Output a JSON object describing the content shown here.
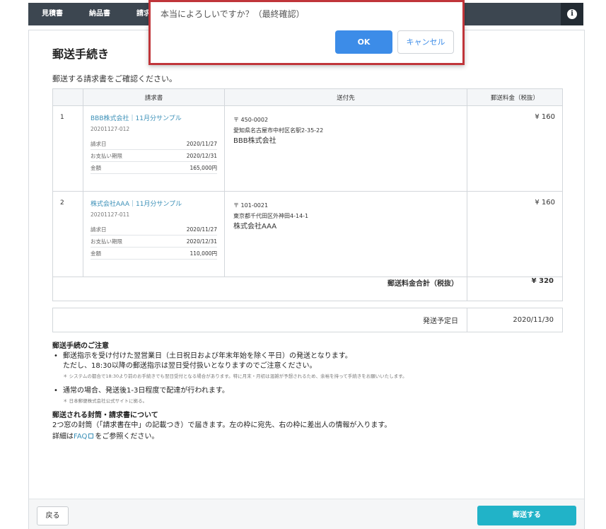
{
  "nav": {
    "items": [
      "見積書",
      "納品書",
      "請求"
    ],
    "info_glyph": "i"
  },
  "page": {
    "title": "郵送手続き",
    "intro": "郵送する請求書をご確認ください。"
  },
  "table": {
    "headers": [
      "",
      "請求書",
      "送付先",
      "郵送料金（税抜）"
    ],
    "rows": [
      {
        "num": "1",
        "invoice_title": "BBB株式会社｜11月分サンプル",
        "invoice_id": "20201127-012",
        "details": [
          {
            "label": "請求日",
            "value": "2020/11/27"
          },
          {
            "label": "お支払い期限",
            "value": "2020/12/31"
          },
          {
            "label": "金額",
            "value": "165,000円"
          }
        ],
        "postal": "〒 450-0002",
        "address": "愛知県名古屋市中村区名駅2-35-22",
        "company": "BBB株式会社",
        "fee": "¥ 160"
      },
      {
        "num": "2",
        "invoice_title": "株式会社AAA｜11月分サンプル",
        "invoice_id": "20201127-011",
        "details": [
          {
            "label": "請求日",
            "value": "2020/11/27"
          },
          {
            "label": "お支払い期限",
            "value": "2020/12/31"
          },
          {
            "label": "金額",
            "value": "110,000円"
          }
        ],
        "postal": "〒 101-0021",
        "address": "東京都千代田区外神田4-14-1",
        "company": "株式会社AAA",
        "fee": "¥ 160"
      }
    ],
    "total_label": "郵送料金合計（税抜）",
    "total_value": "¥ 320"
  },
  "shipping": {
    "label": "発送予定日",
    "date": "2020/11/30"
  },
  "notes": {
    "heading1": "郵送手続のご注意",
    "bullet1_line1": "郵送指示を受け付けた翌営業日（土日祝日および年末年始を除く平日）の発送となります。",
    "bullet1_line2": "ただし、18:30以降の郵送指示は翌日受付扱いとなりますのでご注意ください。",
    "bullet1_small": "＊ システムの都合で18:30より前のお手続きでも翌日受付となる場合があります。特に月末・月初は混雑が予想されるため、余裕を持って手続きをお願いいたします。",
    "bullet2": "通常の場合、発送後1-3日程度で配達が行われます。",
    "bullet2_small": "＊ 日本郵便株式会社公式サイトに拠る。",
    "heading2": "郵送される封筒・請求書について",
    "envelope_text": "2つ窓の封筒（「請求書在中」の記載つき）で届きます。左の枠に宛先、右の枠に差出人の情報が入ります。",
    "detail_prefix": "詳細は",
    "faq_link": "FAQ",
    "detail_suffix": "をご参照ください。"
  },
  "footer": {
    "back_label": "戻る",
    "submit_label": "郵送する"
  },
  "dialog": {
    "message": "本当によろしいですか？（最終確認）",
    "ok_label": "OK",
    "cancel_label": "キャンセル"
  },
  "colors": {
    "topbar": "#3c4650",
    "link": "#3a8fb7",
    "submit": "#21b3c8",
    "ok": "#3c8ce8",
    "highlight_border": "#c0353a"
  }
}
